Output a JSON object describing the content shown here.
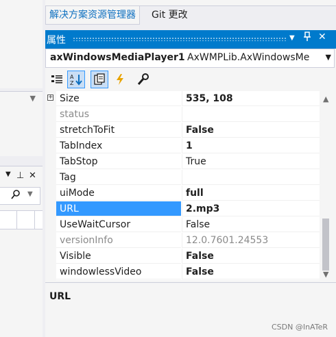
{
  "left": {
    "pane2_pin": "⊥",
    "pane2_close": "✕"
  },
  "tabs": [
    {
      "label": "解决方案资源管理器"
    },
    {
      "label": "Git 更改"
    }
  ],
  "properties": {
    "title": "属性",
    "object_name": "axWindowsMediaPlayer1",
    "object_type": "AxWMPLib.AxWindowsMe",
    "rows": [
      {
        "name": "Size",
        "value": "535, 108",
        "expandable": true,
        "value_bold": true
      },
      {
        "name": "status",
        "value": "",
        "name_gray": true
      },
      {
        "name": "stretchToFit",
        "value": "False",
        "value_bold": true
      },
      {
        "name": "TabIndex",
        "value": "1",
        "value_bold": true
      },
      {
        "name": "TabStop",
        "value": "True"
      },
      {
        "name": "Tag",
        "value": ""
      },
      {
        "name": "uiMode",
        "value": "full",
        "value_bold": true
      },
      {
        "name": "URL",
        "value": "2.mp3",
        "value_bold": true,
        "selected": true
      },
      {
        "name": "UseWaitCursor",
        "value": "False"
      },
      {
        "name": "versionInfo",
        "value": "12.0.7601.24553",
        "name_gray": true,
        "value_gray": true
      },
      {
        "name": "Visible",
        "value": "False",
        "value_bold": true
      },
      {
        "name": "windowlessVideo",
        "value": "False",
        "value_bold": true
      }
    ],
    "description_title": "URL"
  },
  "watermark": "CSDN @InATeR",
  "colors": {
    "accent": "#007acc",
    "selection": "#3399ff",
    "tab_text": "#0e70c0"
  }
}
